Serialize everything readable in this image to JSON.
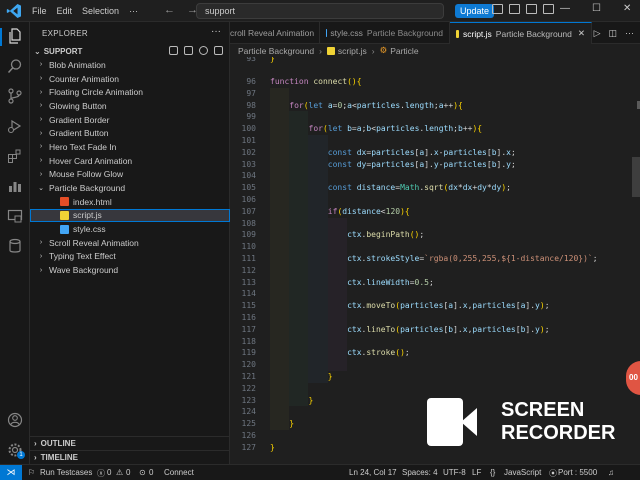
{
  "titlebar": {
    "menus": [
      "File",
      "Edit",
      "Selection"
    ],
    "more_menu": "···",
    "search": "support",
    "update_label": "Update"
  },
  "explorer": {
    "title": "EXPLORER",
    "more": "···",
    "workspace": "SUPPORT",
    "items": [
      {
        "label": "Blob Animation",
        "type": "folder"
      },
      {
        "label": "Counter Animation",
        "type": "folder"
      },
      {
        "label": "Floating Circle Animation",
        "type": "folder"
      },
      {
        "label": "Glowing Button",
        "type": "folder"
      },
      {
        "label": "Gradient Border",
        "type": "folder"
      },
      {
        "label": "Gradient Button",
        "type": "folder"
      },
      {
        "label": "Hero Text Fade In",
        "type": "folder"
      },
      {
        "label": "Hover Card Animation",
        "type": "folder"
      },
      {
        "label": "Mouse Follow Glow",
        "type": "folder"
      },
      {
        "label": "Particle Background",
        "type": "folder-open"
      },
      {
        "label": "index.html",
        "type": "html"
      },
      {
        "label": "script.js",
        "type": "js",
        "selected": true
      },
      {
        "label": "style.css",
        "type": "css"
      },
      {
        "label": "Scroll Reveal Animation",
        "type": "folder"
      },
      {
        "label": "Typing Text Effect",
        "type": "folder"
      },
      {
        "label": "Wave Background",
        "type": "folder"
      }
    ],
    "outline": "OUTLINE",
    "timeline": "TIMELINE"
  },
  "tabs": [
    {
      "name": "croll Reveal Animation",
      "path": ""
    },
    {
      "name": "style.css",
      "path": "Particle Background"
    },
    {
      "name": "script.js",
      "path": "Particle Background",
      "active": true
    }
  ],
  "breadcrumb": {
    "folder": "Particle Background",
    "file": "script.js",
    "symbol": "Particle"
  },
  "editor": {
    "lines": [
      {
        "n": "93",
        "code": "}"
      },
      {
        "n": "96",
        "code": "function connect(){"
      },
      {
        "n": "97",
        "code": ""
      },
      {
        "n": "98",
        "code": "    for(let a=0;a<particles.length;a++){"
      },
      {
        "n": "99",
        "code": ""
      },
      {
        "n": "100",
        "code": "        for(let b=a;b<particles.length;b++){"
      },
      {
        "n": "101",
        "code": ""
      },
      {
        "n": "102",
        "code": "            const dx=particles[a].x-particles[b].x;"
      },
      {
        "n": "103",
        "code": "            const dy=particles[a].y-particles[b].y;"
      },
      {
        "n": "104",
        "code": ""
      },
      {
        "n": "105",
        "code": "            const distance=Math.sqrt(dx*dx+dy*dy);"
      },
      {
        "n": "106",
        "code": ""
      },
      {
        "n": "107",
        "code": "            if(distance<120){"
      },
      {
        "n": "108",
        "code": ""
      },
      {
        "n": "109",
        "code": "                ctx.beginPath();"
      },
      {
        "n": "110",
        "code": ""
      },
      {
        "n": "111",
        "code": "                ctx.strokeStyle=`rgba(0,255,255,${1-distance/120})`;"
      },
      {
        "n": "112",
        "code": ""
      },
      {
        "n": "113",
        "code": "                ctx.lineWidth=0.5;"
      },
      {
        "n": "114",
        "code": ""
      },
      {
        "n": "115",
        "code": "                ctx.moveTo(particles[a].x,particles[a].y);"
      },
      {
        "n": "116",
        "code": ""
      },
      {
        "n": "117",
        "code": "                ctx.lineTo(particles[b].x,particles[b].y);"
      },
      {
        "n": "118",
        "code": ""
      },
      {
        "n": "119",
        "code": "                ctx.stroke();"
      },
      {
        "n": "120",
        "code": ""
      },
      {
        "n": "121",
        "code": "            }"
      },
      {
        "n": "122",
        "code": ""
      },
      {
        "n": "123",
        "code": "        }"
      },
      {
        "n": "124",
        "code": ""
      },
      {
        "n": "125",
        "code": "    }"
      },
      {
        "n": "126",
        "code": ""
      },
      {
        "n": "127",
        "code": "}"
      }
    ]
  },
  "statusbar": {
    "run": "Run Testcases",
    "errors": "0",
    "warnings": "0",
    "ports_count": "0",
    "connect": "Connect",
    "position": "Ln 24, Col 17",
    "spaces": "Spaces: 4",
    "encoding": "UTF-8",
    "eol": "LF",
    "language": "JavaScript",
    "port": "Port : 5500",
    "badge": "1"
  },
  "overlay": {
    "line1": "SCREEN",
    "line2": "RECORDER",
    "timer": "00"
  },
  "colors": {
    "accent": "#0078d4",
    "keyword": "#569cd6",
    "function_kw": "#c586c0",
    "function_name": "#dcdcaa",
    "variable": "#9cdcfe",
    "number": "#b5cea8",
    "string": "#ce9178"
  }
}
